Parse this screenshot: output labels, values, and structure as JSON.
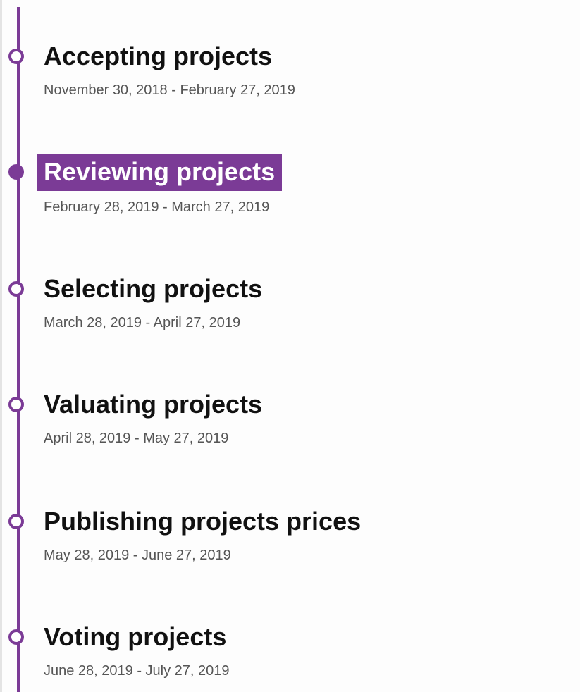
{
  "accent_color": "#7b3b96",
  "timeline": {
    "phases": [
      {
        "title": "Accepting projects",
        "dates": "November 30, 2018 - February 27, 2019",
        "active": false
      },
      {
        "title": "Reviewing projects",
        "dates": "February 28, 2019 - March 27, 2019",
        "active": true
      },
      {
        "title": "Selecting projects",
        "dates": "March 28, 2019 - April 27, 2019",
        "active": false
      },
      {
        "title": "Valuating projects",
        "dates": "April 28, 2019 - May 27, 2019",
        "active": false
      },
      {
        "title": "Publishing projects prices",
        "dates": "May 28, 2019 - June 27, 2019",
        "active": false
      },
      {
        "title": "Voting projects",
        "dates": "June 28, 2019 - July 27, 2019",
        "active": false
      }
    ]
  }
}
